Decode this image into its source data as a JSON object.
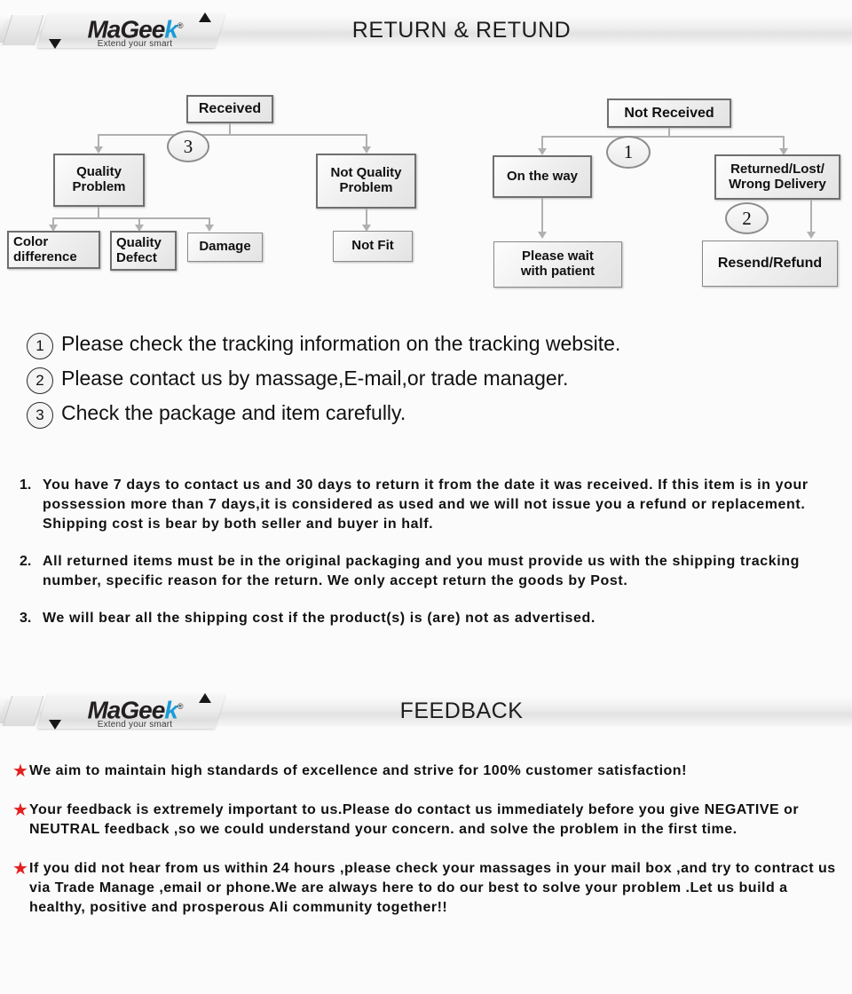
{
  "brand": {
    "name_a": "MaGee",
    "name_k": "k",
    "registered": "®",
    "tagline": "Extend your smart",
    "accent_color": "#1b9bd8"
  },
  "banners": [
    {
      "title": "RETURN & RETUND"
    },
    {
      "title": "FEEDBACK"
    }
  ],
  "flowchart": {
    "left": {
      "root": "Received",
      "badge": "3",
      "children": [
        {
          "label": "Quality\nProblem"
        },
        {
          "label": "Not Quality\nProblem"
        }
      ],
      "quality_children": [
        "Color\ndifference",
        "Quality\nDefect",
        "Damage"
      ],
      "not_quality_child": "Not Fit"
    },
    "right": {
      "root": "Not  Received",
      "badge_top": "1",
      "badge_mid": "2",
      "children": [
        {
          "label": "On the way"
        },
        {
          "label": "Returned/Lost/\nWrong Delivery"
        }
      ],
      "on_the_way_child": "Please wait\nwith patient",
      "returned_child": "Resend/Refund"
    }
  },
  "circled_list": [
    {
      "num": "1",
      "text": "Please check the tracking information on the tracking website."
    },
    {
      "num": "2",
      "text": "Please contact us by  massage,E-mail,or trade manager."
    },
    {
      "num": "3",
      "text": "Check the package and item carefully."
    }
  ],
  "policy": [
    {
      "num": "1.",
      "text": "You have 7 days to contact us and 30 days to return it from the date it was received. If this item is in your possession more than 7 days,it is considered as used and we will not issue you a refund or replacement. Shipping cost is bear by both seller and buyer in half."
    },
    {
      "num": "2.",
      "text": "All returned items must be in the original packaging and you must provide us with the shipping tracking number, specific reason for the return. We only accept return the goods by Post."
    },
    {
      "num": "3.",
      "text": "We will bear all the shipping cost if the product(s) is (are) not as advertised."
    }
  ],
  "feedback": [
    {
      "bullet": "★",
      "text": "We aim to maintain high standards of excellence and strive  for 100% customer satisfaction!"
    },
    {
      "bullet": "★",
      "text": "Your feedback is extremely important to us.Please do contact us immediately before you give NEGATIVE or NEUTRAL feedback ,so  we could understand your concern. and solve the problem in the first time."
    },
    {
      "bullet": "★",
      "text": "If you did not hear from us within 24 hours ,please check your massages in your mail box ,and try to contract us via Trade Manage ,email or phone.We are always here to do our best to solve your problem .Let us build a healthy, positive and prosperous Ali community together!!"
    }
  ]
}
